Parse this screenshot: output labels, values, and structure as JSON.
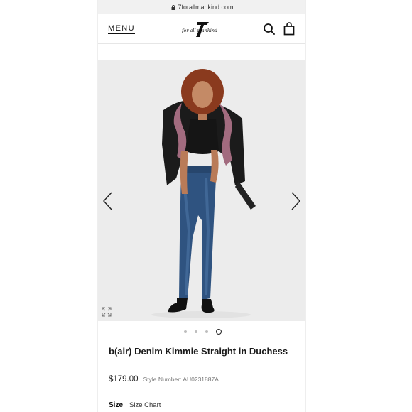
{
  "browser": {
    "url": "7forallmankind.com"
  },
  "header": {
    "menu_label": "MENU",
    "logo_text": "for all mankind",
    "logo_numeral": "7"
  },
  "product": {
    "title": "b(air) Denim Kimmie Straight in Duchess",
    "price": "$179.00",
    "style_number": "Style Number: AU0231887A"
  },
  "gallery": {
    "image_count": 4,
    "active_index": 3
  },
  "size": {
    "label": "Size",
    "chart_link": "Size Chart"
  },
  "colors": {
    "accent": "#111111",
    "background": "#ededed",
    "denim": "#2f5380"
  }
}
